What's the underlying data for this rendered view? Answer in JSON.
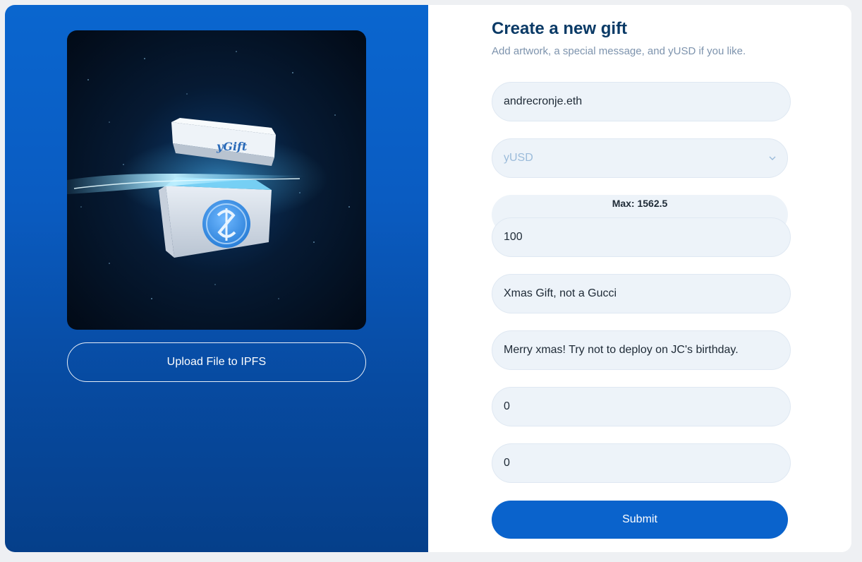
{
  "artwork": {
    "box_lid_text": "yGift",
    "icons": {
      "close": "close-icon",
      "coin": "yearn-coin-icon"
    }
  },
  "upload_button_label": "Upload File to IPFS",
  "form": {
    "title": "Create a new gift",
    "subtitle": "Add artwork, a special message, and yUSD if you like.",
    "recipient_value": "andrecronje.eth",
    "token_select": {
      "selected": "yUSD",
      "icon": "chevron-down-icon"
    },
    "max_label": "Max: 1562.5",
    "amount_value": "100",
    "name_value": "Xmas Gift, not a Gucci",
    "message_value": "Merry xmas! Try not to deploy on JC's birthday.",
    "field6_value": "0",
    "field7_value": "0",
    "submit_label": "Submit"
  },
  "colors": {
    "accent": "#0a63cc",
    "title": "#0a3a66",
    "subtitle": "#7d93ad",
    "field_bg": "#edf3f9"
  }
}
